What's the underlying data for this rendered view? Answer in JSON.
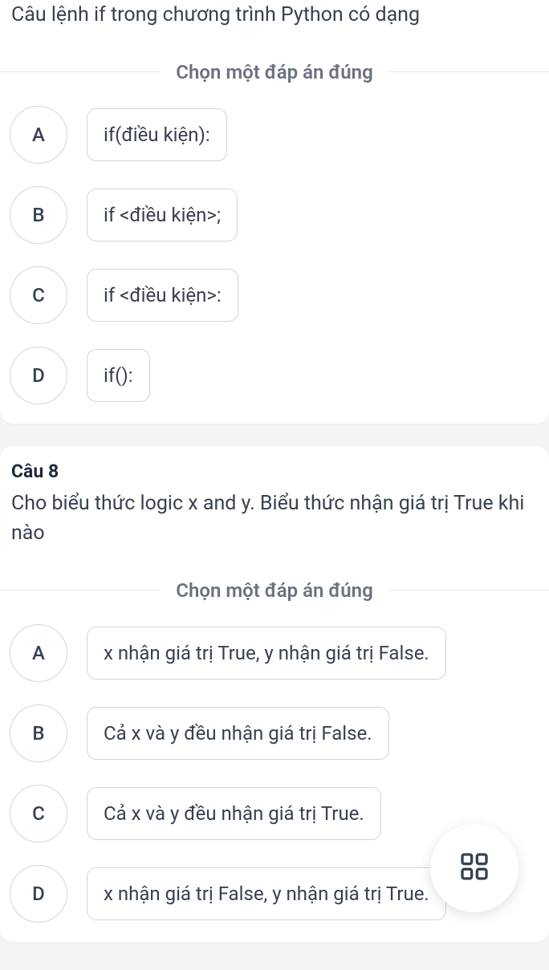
{
  "q7": {
    "text": "Câu lệnh if trong chương trình Python có dạng",
    "instruction": "Chọn một đáp án đúng",
    "options": [
      {
        "letter": "A",
        "text": "if(điều kiện):"
      },
      {
        "letter": "B",
        "text": "if <điều kiện>;"
      },
      {
        "letter": "C",
        "text": "if <điều kiện>:"
      },
      {
        "letter": "D",
        "text": "if():"
      }
    ]
  },
  "q8": {
    "header": "Câu 8",
    "text": "Cho biểu thức logic x and y. Biểu thức nhận giá trị True khi nào",
    "instruction": "Chọn một đáp án đúng",
    "options": [
      {
        "letter": "A",
        "text": "x nhận giá trị True, y nhận giá trị False."
      },
      {
        "letter": "B",
        "text": "Cả x và y đều nhận giá trị False."
      },
      {
        "letter": "C",
        "text": "Cả x và y đều nhận giá trị True."
      },
      {
        "letter": "D",
        "text": "x nhận giá trị False, y nhận giá trị True."
      }
    ]
  }
}
